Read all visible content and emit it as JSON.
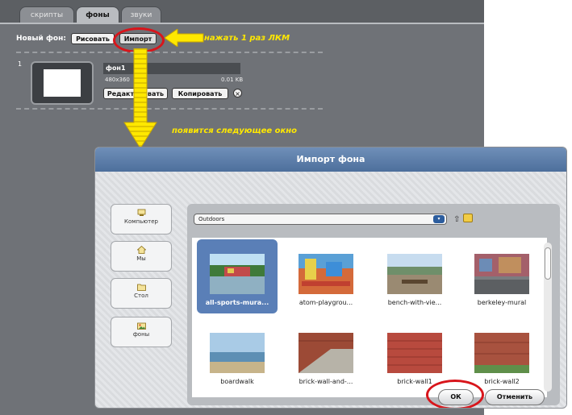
{
  "tabs": [
    {
      "label": "скрипты",
      "active": false
    },
    {
      "label": "фоны",
      "active": true
    },
    {
      "label": "звуки",
      "active": false
    }
  ],
  "new_background": {
    "label": "Новый фон:",
    "paint_label": "Рисовать",
    "import_label": "Импорт"
  },
  "annotations": {
    "click_hint": "нажать 1 раз ЛКМ",
    "window_hint": "появится следующее окно",
    "color": "#ffe800",
    "circle_color": "#d8151b"
  },
  "background_item": {
    "index": "1",
    "name": "фон1",
    "dimensions": "480x360",
    "size": "0.01 KB",
    "edit_label": "Редактировать",
    "copy_label": "Копировать",
    "delete_icon": "×"
  },
  "dialog": {
    "title": "Импорт фона",
    "sidebar": [
      {
        "label": "Компьютер",
        "icon": "computer-icon"
      },
      {
        "label": "Мы",
        "icon": "home-icon"
      },
      {
        "label": "Стол",
        "icon": "folder-icon"
      },
      {
        "label": "фоны",
        "icon": "backgrounds-icon"
      }
    ],
    "folder": "Outdoors",
    "items": [
      {
        "caption": "all-sports-mura...",
        "selected": true
      },
      {
        "caption": "atom-playgrou...",
        "selected": false
      },
      {
        "caption": "bench-with-vie...",
        "selected": false
      },
      {
        "caption": "berkeley-mural",
        "selected": false
      },
      {
        "caption": "boardwalk",
        "selected": false
      },
      {
        "caption": "brick-wall-and-...",
        "selected": false
      },
      {
        "caption": "brick-wall1",
        "selected": false
      },
      {
        "caption": "brick-wall2",
        "selected": false
      }
    ],
    "ok_label": "ОК",
    "cancel_label": "Отменить"
  }
}
